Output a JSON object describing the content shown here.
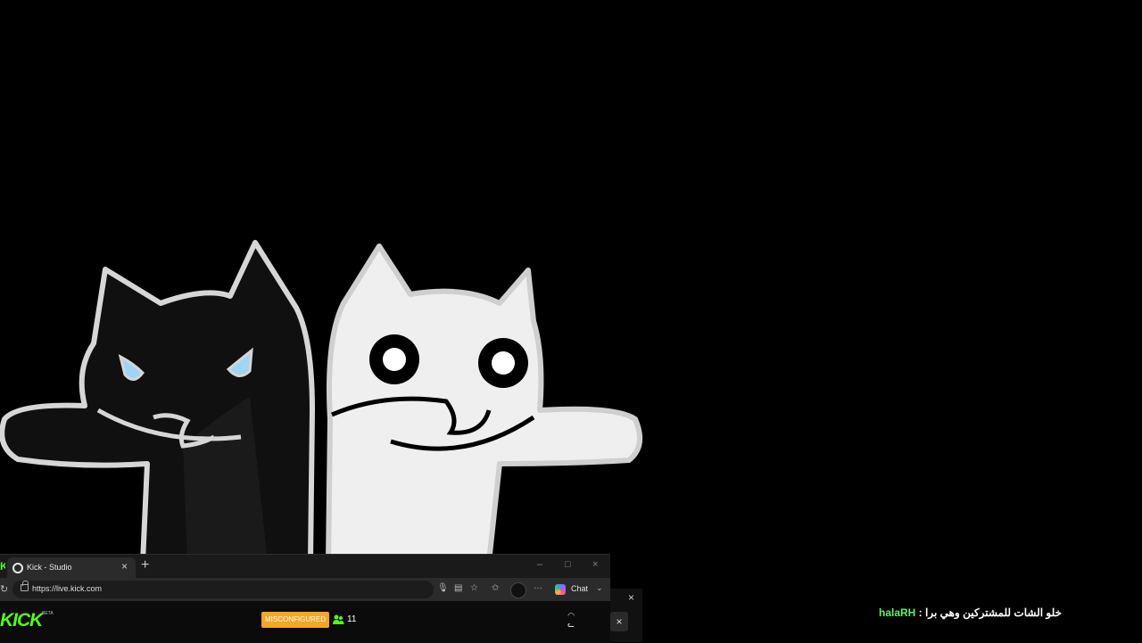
{
  "browser": {
    "tab": {
      "title": "Kick - Studio",
      "close": "×"
    },
    "new_tab": "+",
    "window_controls": {
      "minimize": "–",
      "maximize": "□",
      "close": "×"
    },
    "url": "https://live.kick.com",
    "chat_button": "Chat",
    "icons": [
      "reload-icon",
      "lock-icon",
      "mic-icon",
      "reader-icon",
      "favorite-icon",
      "favorites-bar-icon",
      "more-icon",
      "copilot-icon"
    ]
  },
  "kick": {
    "logo": "KICK",
    "beta": "BETA",
    "status_badge": "MISCONFIGURED",
    "viewers": "11"
  },
  "chat": {
    "username": "halaRH",
    "separator": " : ",
    "message": "خلو الشات للمشتركين وهي برا"
  },
  "colors": {
    "kick_green": "#53fc18",
    "badge_orange": "#f5a623",
    "chat_username": "#5cf06a",
    "background": "#000000"
  }
}
